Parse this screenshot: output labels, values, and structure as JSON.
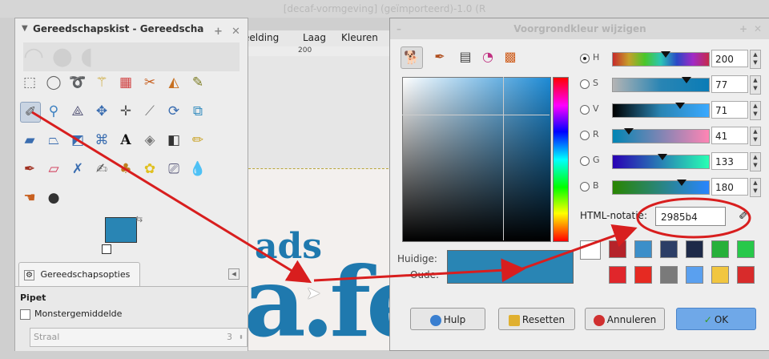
{
  "background_window": {
    "title": "[decaf-vormgeving] (geïmporteerd)-1.0 (R",
    "menus": [
      "eelding",
      "Laag",
      "Kleuren"
    ],
    "ruler_mark": "200",
    "logo_ads": "ads",
    "logo_big": "a.fe"
  },
  "toolbox": {
    "title": "Gereedschapskist - Gereedscha",
    "tab_label": "Gereedschapsopties",
    "tool_name": "Pipet",
    "sample_average_label": "Monstergemiddelde",
    "radius_label": "Straal",
    "radius_value": "3",
    "foreground_color": "#2985b4",
    "background_color": "#ffffff"
  },
  "dialog": {
    "title": "Voorgrondkleur wijzigen",
    "sliders": [
      {
        "label": "H",
        "value": "200",
        "selected": true,
        "marker": 0.55
      },
      {
        "label": "S",
        "value": "77",
        "selected": false,
        "marker": 0.77
      },
      {
        "label": "V",
        "value": "71",
        "selected": false,
        "marker": 0.71
      },
      {
        "label": "R",
        "value": "41",
        "selected": false,
        "marker": 0.16
      },
      {
        "label": "G",
        "value": "133",
        "selected": false,
        "marker": 0.52
      },
      {
        "label": "B",
        "value": "180",
        "selected": false,
        "marker": 0.71
      }
    ],
    "html_label": "HTML-notatie:",
    "html_value": "2985b4",
    "current_label": "Huidige:",
    "old_label": "Oude:",
    "current_color": "#2985b4",
    "history_colors": [
      "#ffffff",
      "#b5232a",
      "#3c8fc9",
      "#2c3e66",
      "#1e2a48",
      "#27b03a",
      "#27c84a",
      "#e0262b",
      "#e62a22",
      "#7a7a7a",
      "#5aa0ef",
      "#f1c640",
      "#d82b2b"
    ],
    "buttons": {
      "help": "Hulp",
      "reset": "Resetten",
      "cancel": "Annuleren",
      "ok": "OK"
    }
  }
}
